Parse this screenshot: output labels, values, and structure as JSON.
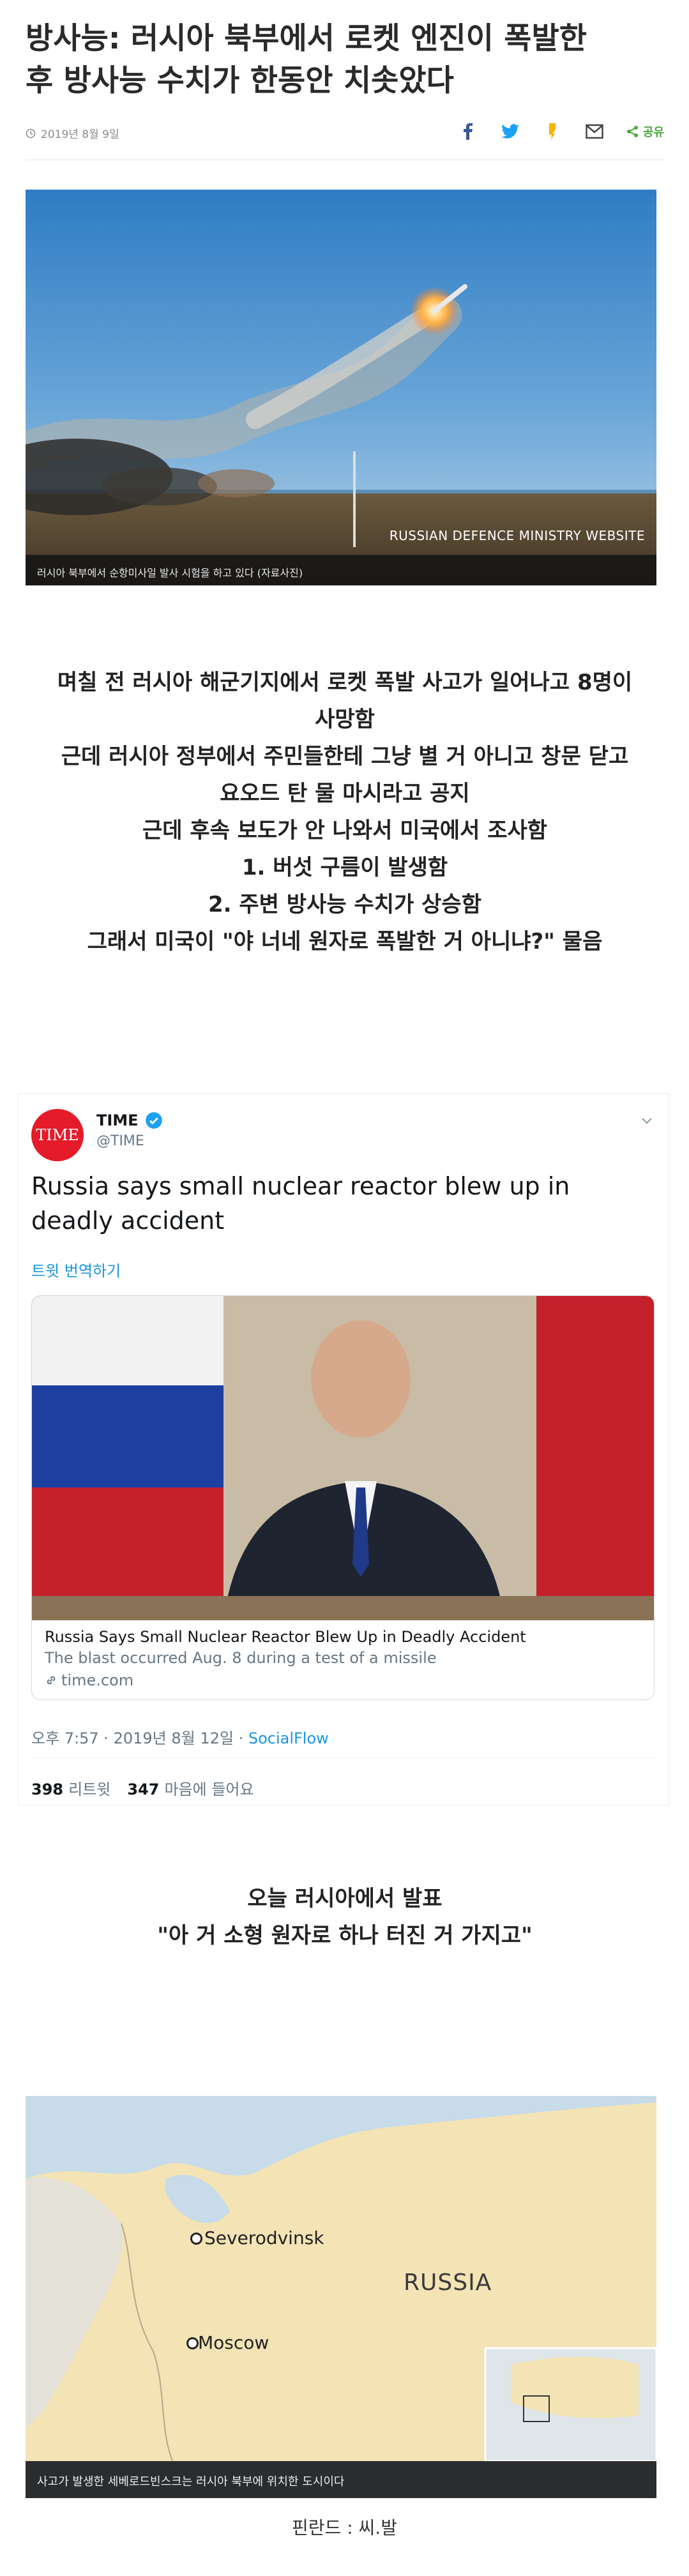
{
  "article": {
    "headline_lines": [
      "방사능: 러시아 북부에서 로켓 엔진이 폭발한",
      "후 방사능 수치가 한동안 치솟았다"
    ],
    "date": "2019년 8월 9일",
    "share_label": "공유",
    "photo_credit": "RUSSIAN DEFENCE MINISTRY WEBSITE",
    "photo_caption": "러시아 북부에서 순항미사일 발사 시험을 하고 있다 (자료사진)"
  },
  "body": {
    "para1": [
      "며칠 전 러시아 해군기지에서 로켓 폭발 사고가 일어나고 8명이",
      "사망함",
      "근데 러시아 정부에서 주민들한테 그냥 별 거 아니고 창문 닫고",
      "요오드 탄 물 마시라고 공지",
      "근데 후속 보도가 안 나와서 미국에서 조사함",
      "1. 버섯 구름이 발생함",
      "2. 주변 방사능 수치가 상승함",
      "그래서 미국이 \"야 너네 원자로 폭발한 거 아니냐?\" 물음"
    ],
    "para2": [
      "오늘 러시아에서 발표",
      "\"아 거 소형 원자로 하나 터진 거 가지고\""
    ]
  },
  "tweet": {
    "avatar_text": "TIME",
    "name": "TIME",
    "handle": "@TIME",
    "text": "Russia says small nuclear reactor blew up in deadly accident",
    "translate": "트윗 번역하기",
    "card_title": "Russia Says Small Nuclear Reactor Blew Up in Deadly Accident",
    "card_desc": "The blast occurred Aug. 8 during a test of a missile",
    "card_domain": "time.com",
    "time": "오후 7:57 · 2019년 8월 12일 · ",
    "source": "SocialFlow",
    "retweets": "398",
    "retweets_label": "리트윗",
    "likes": "347",
    "likes_label": "마음에 들어요"
  },
  "map": {
    "label_severodvinsk": "Severodvinsk",
    "label_moscow": "Moscow",
    "label_russia": "RUSSIA",
    "caption": "사고가 발생한 세베로드빈스크는 러시아 북부에 위치한 도시이다"
  },
  "footer": {
    "note": "핀란드 : 씨.발"
  },
  "colors": {
    "twitter_blue": "#1b95e0",
    "time_red": "#e51b2a",
    "share_green": "#4aa83a"
  }
}
